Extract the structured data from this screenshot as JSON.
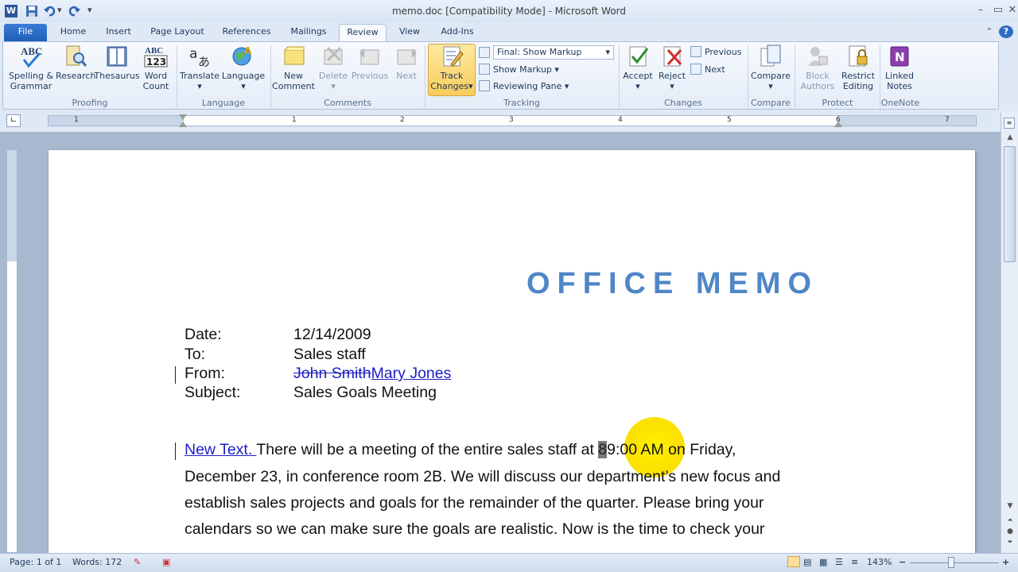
{
  "window": {
    "title": "memo.doc [Compatibility Mode]  -  Microsoft Word"
  },
  "tabs": [
    "File",
    "Home",
    "Insert",
    "Page Layout",
    "References",
    "Mailings",
    "Review",
    "View",
    "Add-Ins"
  ],
  "ribbon": {
    "proofing": {
      "label": "Proofing",
      "spelling": "Spelling &",
      "spelling2": "Grammar",
      "research": "Research",
      "thesaurus": "Thesaurus",
      "word": "Word",
      "count": "Count"
    },
    "language": {
      "label": "Language",
      "translate": "Translate",
      "language": "Language"
    },
    "comments": {
      "label": "Comments",
      "new1": "New",
      "new2": "Comment",
      "delete": "Delete",
      "previous": "Previous",
      "next": "Next"
    },
    "tracking": {
      "label": "Tracking",
      "track1": "Track",
      "track2": "Changes",
      "display": "Final: Show Markup",
      "show_markup": "Show Markup",
      "reviewing_pane": "Reviewing Pane"
    },
    "changes": {
      "label": "Changes",
      "accept": "Accept",
      "reject": "Reject",
      "previous": "Previous",
      "next": "Next"
    },
    "compare": {
      "label": "Compare",
      "compare": "Compare"
    },
    "protect": {
      "label": "Protect",
      "block1": "Block",
      "block2": "Authors",
      "restrict1": "Restrict",
      "restrict2": "Editing"
    },
    "onenote": {
      "label": "OneNote",
      "linked1": "Linked",
      "linked2": "Notes"
    }
  },
  "ruler": {
    "numbers": [
      "1",
      "1",
      "2",
      "3",
      "4",
      "5",
      "6",
      "7"
    ]
  },
  "document": {
    "heading": "OFFICE MEMO",
    "date_label": "Date:",
    "date_value": "12/14/2009",
    "to_label": "To:",
    "to_value": "Sales staff",
    "from_label": "From:",
    "from_deleted": "John Smith",
    "from_inserted": "Mary Jones",
    "subject_label": "Subject:",
    "subject_value": "Sales Goals Meeting",
    "para_inserted": "New Text. ",
    "para_line1a": "There will be a meeting of the entire sales staff at ",
    "para_line1_cursor": "8",
    "para_line1b": "9:00 AM on Friday,",
    "para_line2": "December 23, in conference room 2B. We  will discuss our department’s new focus and",
    "para_line3": "establish sales projects and goals for the remainder of the quarter. Please bring your",
    "para_line4": "calendars so we can make sure the goals are realistic. Now is the time to check your"
  },
  "status": {
    "page": "Page: 1 of 1",
    "words": "Words: 172",
    "zoom": "143%"
  }
}
